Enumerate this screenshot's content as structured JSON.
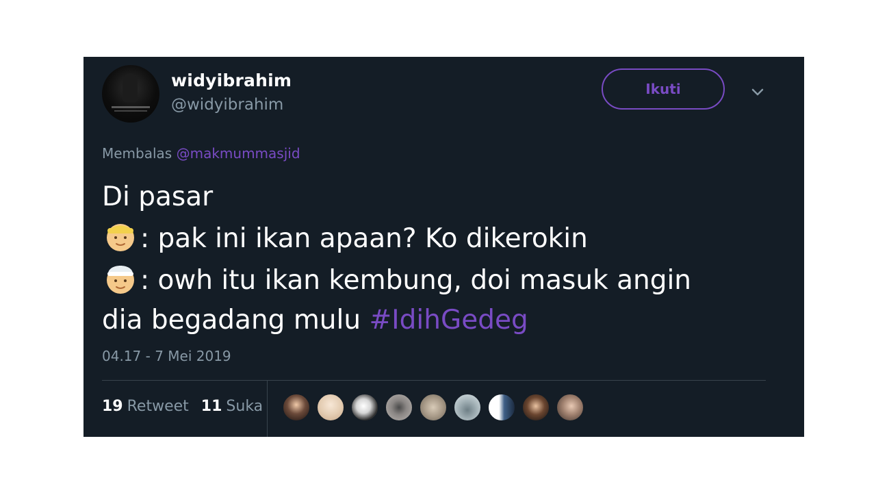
{
  "user": {
    "display_name": "widyibrahim",
    "handle": "@widyibrahim"
  },
  "follow_button": {
    "label": "Ikuti"
  },
  "reply": {
    "prefix": "Membalas",
    "mention": "@makmummasjid"
  },
  "tweet": {
    "line1": "Di pasar",
    "line2": ": pak ini ikan apaan? Ko dikerokin",
    "line3": ": owh itu ikan kembung, doi masuk angin",
    "line4": "dia begadang mulu ",
    "hashtag": "#IdihGedeg"
  },
  "timestamp": "04.17 - 7 Mei 2019",
  "stats": {
    "retweet_count": "19",
    "retweet_label": "Retweet",
    "like_count": "11",
    "like_label": "Suka"
  },
  "icons": {
    "emoji_1": "person-blond-emoji",
    "emoji_2": "man-with-cap-emoji",
    "menu": "chevron-down-icon"
  },
  "colors": {
    "background": "#141d26",
    "accent": "#794bc4",
    "secondary_text": "#8899a6"
  },
  "liked_by_count": 9
}
